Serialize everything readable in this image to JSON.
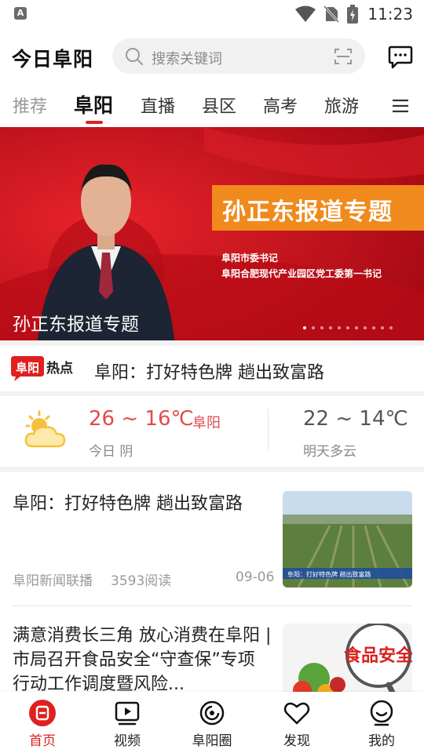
{
  "status_bar": {
    "app_badge": "A",
    "time": "11:23"
  },
  "header": {
    "logo": "今日阜阳",
    "search_placeholder": "搜索关键词"
  },
  "tabs": [
    {
      "label": "推荐"
    },
    {
      "label": "阜阳"
    },
    {
      "label": "直播"
    },
    {
      "label": "县区"
    },
    {
      "label": "高考"
    },
    {
      "label": "旅游"
    }
  ],
  "active_tab": "阜阳",
  "banner": {
    "title": "孙正东报道专题",
    "subtitle_1": "阜阳市委书记",
    "subtitle_2": "阜阳合肥现代产业园区党工委第一书记",
    "caption": "孙正东报道专题",
    "slide_count": 11,
    "active_slide": 1
  },
  "hot": {
    "badge_1": "阜阳",
    "badge_2": "热点",
    "text": "阜阳：打好特色牌 趟出致富路"
  },
  "weather": {
    "today_temp": "26 ~ 16℃",
    "city": "阜阳",
    "today_desc": "今日 阴",
    "tomorrow_temp": "22 ~ 14℃",
    "tomorrow_desc": "明天多云"
  },
  "news": [
    {
      "title": "阜阳：打好特色牌 趟出致富路",
      "source": "阜阳新闻联播",
      "reads": "3593阅读",
      "date": "09-06",
      "thumb_caption": "阜阳：打好特色牌 趟出致富路"
    },
    {
      "title": "满意消费长三角 放心消费在阜阳 | 市局召开食品安全“守查保”专项行动工作调度暨风险...",
      "thumb_caption": "食品安全"
    }
  ],
  "bottom_nav": [
    {
      "label": "首页",
      "icon": "home-icon"
    },
    {
      "label": "视频",
      "icon": "video-icon"
    },
    {
      "label": "阜阳圈",
      "icon": "circle-icon"
    },
    {
      "label": "发现",
      "icon": "heart-icon"
    },
    {
      "label": "我的",
      "icon": "profile-icon"
    }
  ],
  "colors": {
    "accent": "#e02020",
    "banner_red": "#c8101c",
    "banner_orange": "#f08a1c",
    "temp_red": "#e14b4b"
  }
}
